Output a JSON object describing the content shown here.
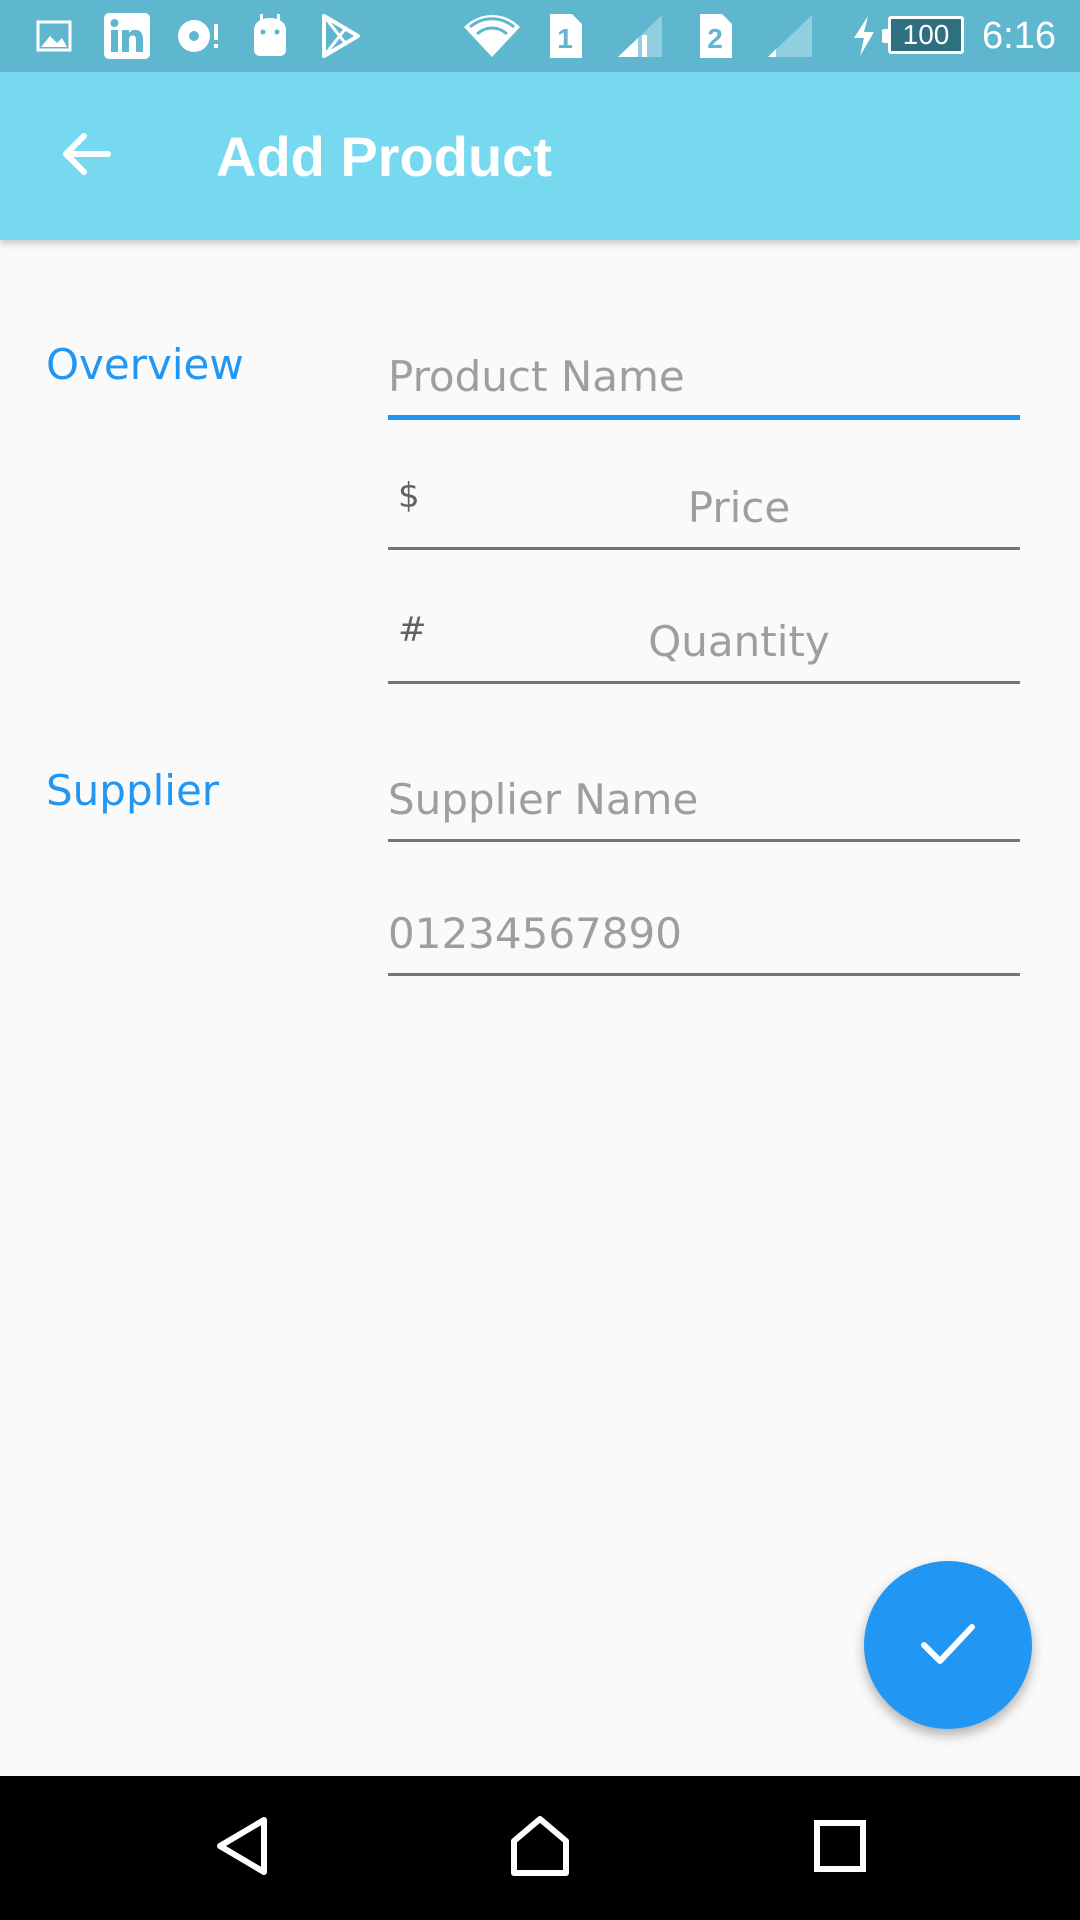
{
  "status_bar": {
    "time": "6:16",
    "battery_level": "100",
    "sim1_label": "1",
    "sim2_label": "2",
    "notification_icons": [
      "gallery-icon",
      "linkedin-icon",
      "media-icon",
      "android-icon",
      "play-store-icon"
    ],
    "colors": {
      "background": "#5fb6cf"
    }
  },
  "app_bar": {
    "title": "Add Product",
    "colors": {
      "background": "#76d9f0"
    }
  },
  "form": {
    "overview": {
      "label": "Overview",
      "product_name": {
        "placeholder": "Product Name",
        "value": ""
      },
      "price": {
        "prefix": "$",
        "placeholder": "Price",
        "value": ""
      },
      "quantity": {
        "prefix": "#",
        "placeholder": "Quantity",
        "value": ""
      }
    },
    "supplier": {
      "label": "Supplier",
      "supplier_name": {
        "placeholder": "Supplier Name",
        "value": ""
      },
      "supplier_phone": {
        "placeholder": "01234567890",
        "value": ""
      }
    }
  },
  "fab": {
    "icon": "check-icon",
    "color": "#2196f3"
  },
  "nav_bar": {
    "icons": [
      "back-triangle-icon",
      "home-icon",
      "recents-icon"
    ]
  }
}
